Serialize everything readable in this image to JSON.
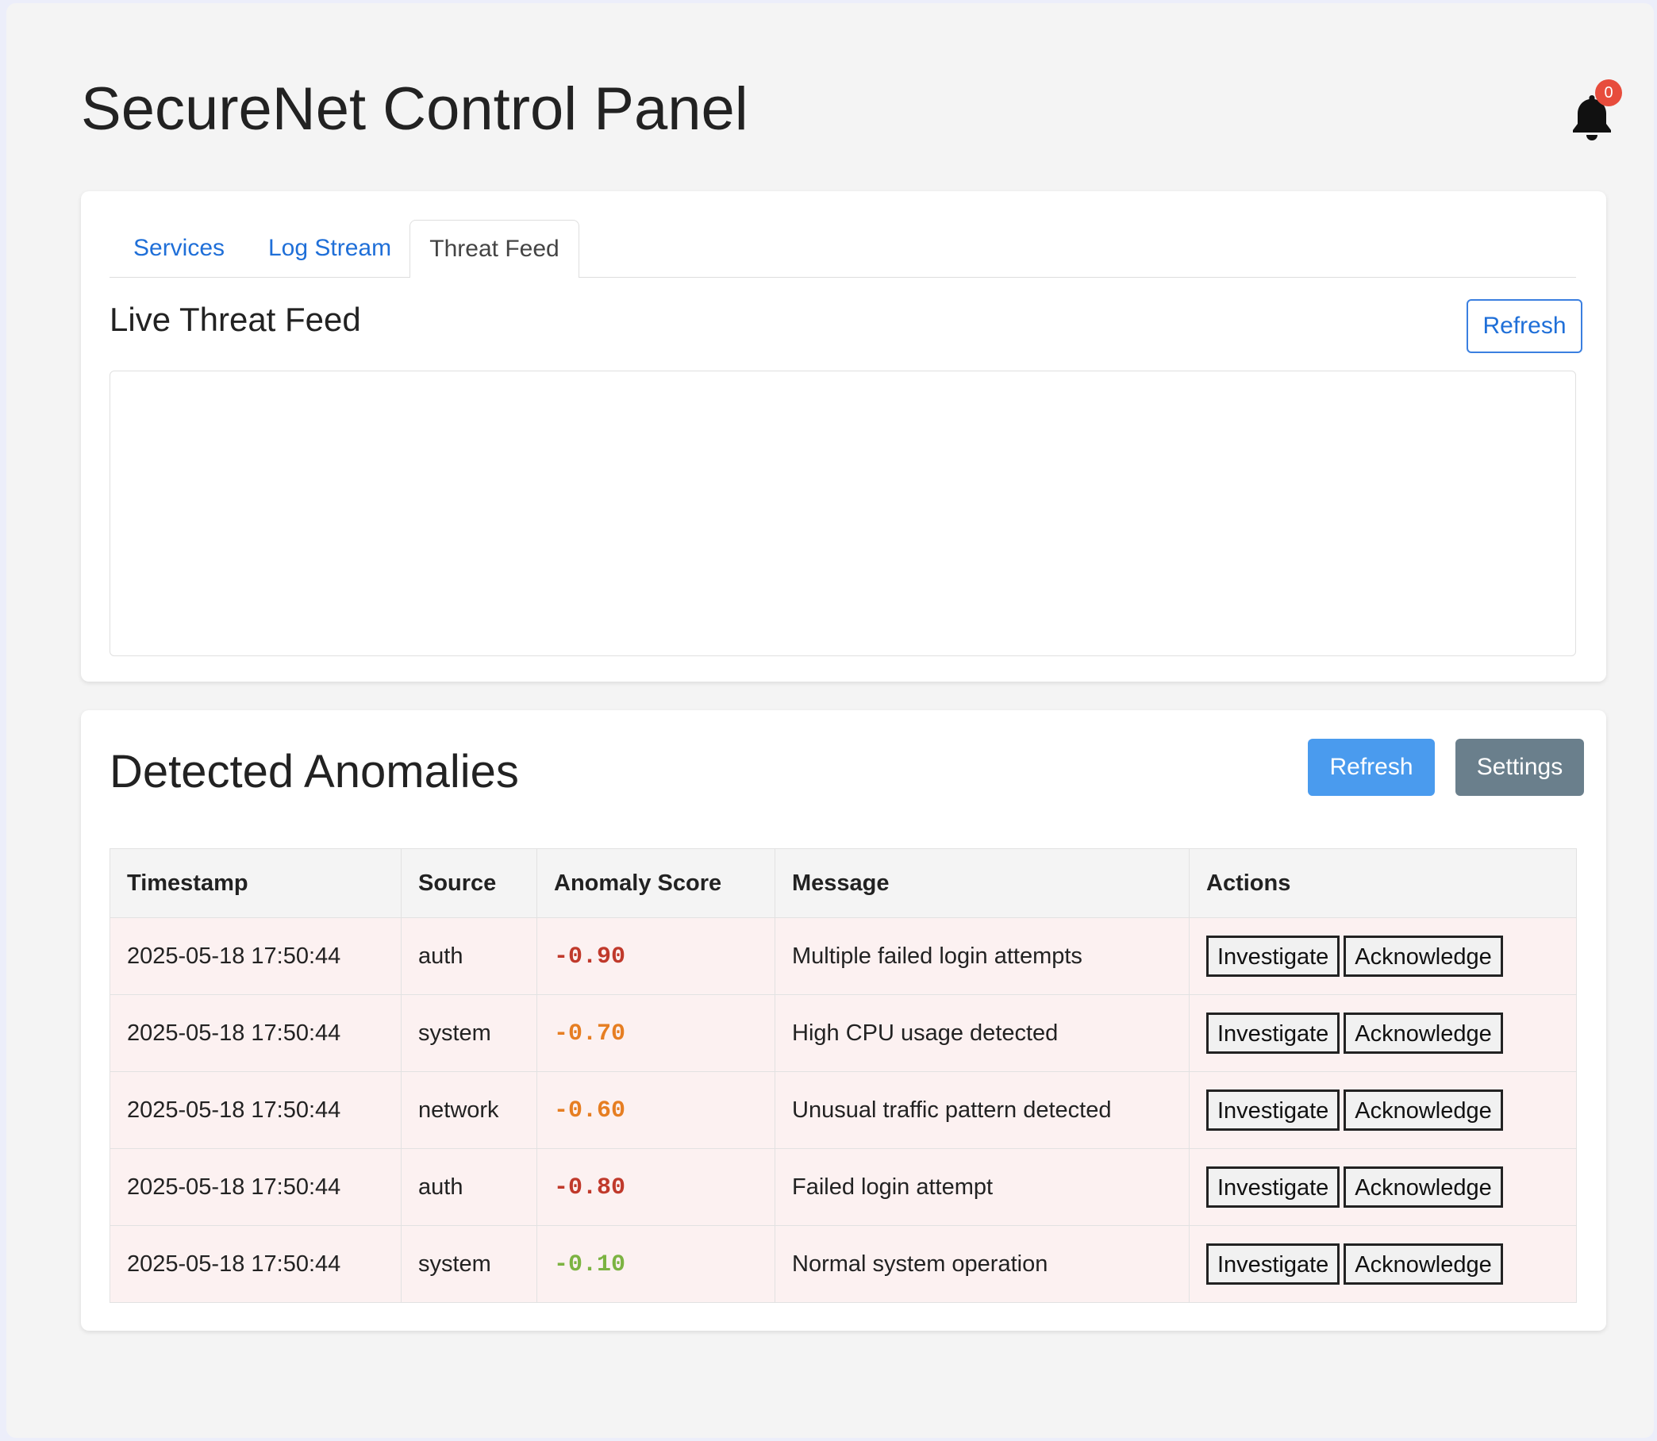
{
  "header": {
    "title": "SecureNet Control Panel",
    "notification_count": "0"
  },
  "tabs": [
    {
      "label": "Services",
      "active": false
    },
    {
      "label": "Log Stream",
      "active": false
    },
    {
      "label": "Threat Feed",
      "active": true
    }
  ],
  "threat_feed": {
    "title": "Live Threat Feed",
    "refresh_label": "Refresh"
  },
  "anomalies": {
    "title": "Detected Anomalies",
    "refresh_label": "Refresh",
    "settings_label": "Settings",
    "columns": [
      "Timestamp",
      "Source",
      "Anomaly Score",
      "Message",
      "Actions"
    ],
    "rows": [
      {
        "timestamp": "2025-05-18 17:50:44",
        "source": "auth",
        "score": "-0.90",
        "score_color": "#c0392b",
        "message": "Multiple failed login attempts"
      },
      {
        "timestamp": "2025-05-18 17:50:44",
        "source": "system",
        "score": "-0.70",
        "score_color": "#e67e22",
        "message": "High CPU usage detected"
      },
      {
        "timestamp": "2025-05-18 17:50:44",
        "source": "network",
        "score": "-0.60",
        "score_color": "#e67e22",
        "message": "Unusual traffic pattern detected"
      },
      {
        "timestamp": "2025-05-18 17:50:44",
        "source": "auth",
        "score": "-0.80",
        "score_color": "#c0392b",
        "message": "Failed login attempt"
      },
      {
        "timestamp": "2025-05-18 17:50:44",
        "source": "system",
        "score": "-0.10",
        "score_color": "#7cb342",
        "message": "Normal system operation"
      }
    ],
    "investigate_label": "Investigate",
    "acknowledge_label": "Acknowledge"
  },
  "colors": {
    "link": "#1f6fd8",
    "primary_button": "#4a9bee",
    "secondary_button": "#6a7f8c",
    "badge": "#e74c3c",
    "row_background": "#fcf1f1"
  },
  "icons": {
    "notification": "bell-icon"
  }
}
